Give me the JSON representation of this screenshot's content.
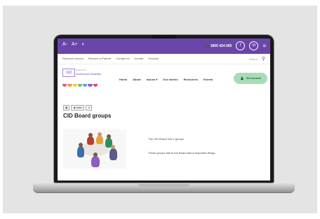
{
  "site": {
    "topbar": {
      "font_small": "A-",
      "font_large": "A+",
      "contrast_icon": "contrast-icon",
      "phone": "📞 1800 424 065",
      "social": [
        "f",
        "in"
      ],
      "menu_icon": "hamburger-icon"
    },
    "navbar": {
      "links": [
        "Reduced version",
        "Become a Partner",
        "Contact us",
        "Donate",
        "Podcast"
      ],
      "search_label": "Search"
    },
    "header": {
      "logo_letters": "cid",
      "logo_line1": "Council for",
      "logo_line2": "Intellectual Disability",
      "nav": [
        "Home",
        "About",
        "Issues ▾",
        "Our stories",
        "Resources",
        "Events"
      ],
      "download_label": "Get Involved"
    },
    "controls": [
      "▣",
      "◀ Listen",
      "✕"
    ],
    "page_title": "CID Board groups",
    "body": {
      "line1": "The CID Board has 2 groups.",
      "line2": "These groups talk to the Board about important things."
    }
  },
  "colors": {
    "brand_purple": "#6a46ab",
    "button_green": "#a8dcb6",
    "logo_dots": [
      "#e05a8a",
      "#f39b34",
      "#f5c842",
      "#6cc07a",
      "#4aa8d8",
      "#8a5cc4",
      "#d8468a"
    ]
  }
}
